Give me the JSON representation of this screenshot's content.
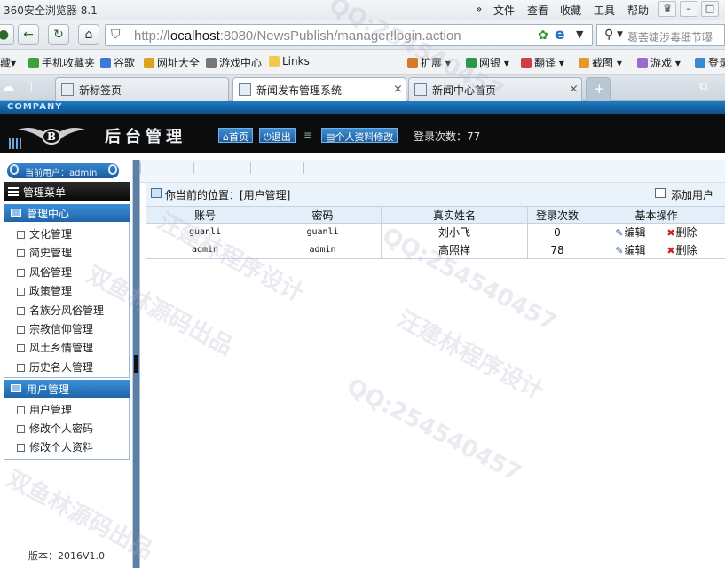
{
  "browser": {
    "window_title": "360安全浏览器 8.1",
    "menu": [
      "文件",
      "查看",
      "收藏",
      "工具",
      "帮助"
    ],
    "url_host": "http://",
    "url_main": "localhost",
    "url_rest": ":8080/NewsPublish/manager!login.action",
    "search_placeholder": "葛荟婕涉毒细节曝",
    "favorites": [
      "手机收藏夹",
      "谷歌",
      "网址大全",
      "游戏中心",
      "Links"
    ],
    "toolbar_right": [
      "扩展",
      "网银",
      "翻译",
      "截图",
      "游戏",
      "登录"
    ],
    "tabs": [
      "新标签页",
      "新闻发布管理系统",
      "新闻中心首页"
    ]
  },
  "header": {
    "company": "COMPANY",
    "title": "后台管理",
    "home": "首页",
    "logout": "退出",
    "profile": "个人资料修改",
    "login_count": "登录次数：77"
  },
  "sidebar": {
    "current_user": "当前用户：admin",
    "menu_title": "管理菜单",
    "groups": [
      {
        "title": "管理中心",
        "items": [
          "文化管理",
          "简史管理",
          "风俗管理",
          "政策管理",
          "名族分风俗管理",
          "宗教信仰管理",
          "风土乡情管理",
          "历史名人管理"
        ]
      },
      {
        "title": "用户管理",
        "items": [
          "用户管理",
          "修改个人密码",
          "修改个人资料"
        ]
      }
    ],
    "version": "版本：2016V1.0"
  },
  "main": {
    "location": "你当前的位置：[用户管理]",
    "add_user": "添加用户",
    "columns": [
      "账号",
      "密码",
      "真实姓名",
      "登录次数",
      "基本操作"
    ],
    "rows": [
      {
        "account": "guanli",
        "password": "guanli",
        "name": "刘小飞",
        "count": "0"
      },
      {
        "account": "admin",
        "password": "admin",
        "name": "高照祥",
        "count": "78"
      }
    ],
    "edit": "编辑",
    "delete": "删除"
  },
  "watermarks": [
    "QQ:254540457",
    "汪建林程序设计",
    "双鱼林源码出品"
  ]
}
